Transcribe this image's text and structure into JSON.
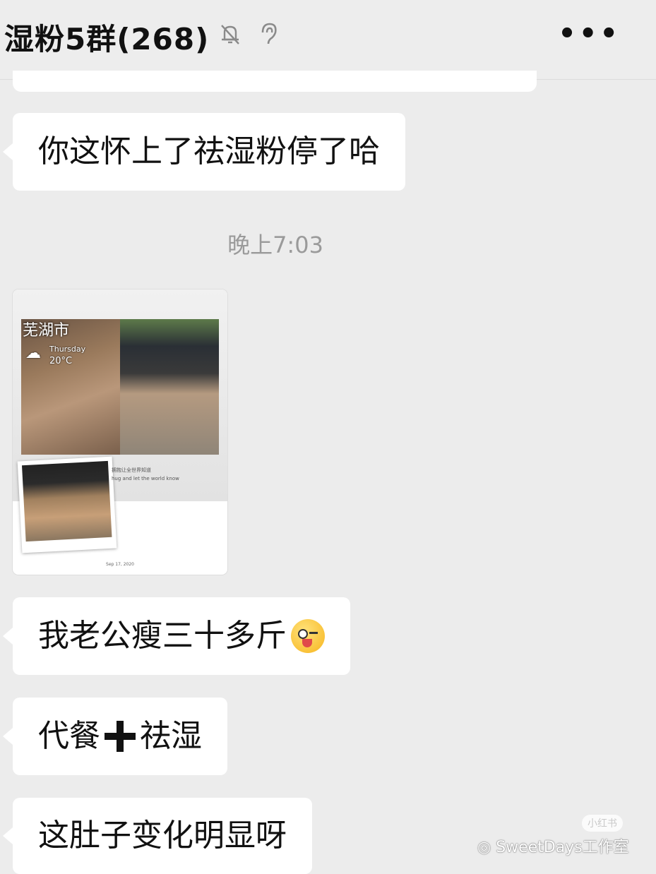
{
  "header": {
    "title": "湿粉5群(268)",
    "icons": [
      "mute-bell-icon",
      "ear-icon"
    ],
    "more_label": "•••"
  },
  "messages": [
    {
      "text": "你这怀上了祛湿粉停了哈"
    },
    {
      "time": "晚上7:03"
    },
    {
      "image": {
        "city": "芜湖市",
        "weekday": "Thursday",
        "temperature": "20°C",
        "caption_line1": "拥抱让全世界知道",
        "caption_line2": "hug and let the world know",
        "date": "Sep 17, 2020"
      }
    },
    {
      "text": "我老公瘦三十多斤",
      "emoji": "winking-tongue-emoji"
    },
    {
      "text_before": "代餐",
      "symbol": "plus-icon",
      "text_after": "祛湿"
    },
    {
      "text": "这肚子变化明显呀"
    }
  ],
  "watermark": {
    "badge": "小红书",
    "label": "SweetDays工作室",
    "icon": "wechat-icon"
  }
}
